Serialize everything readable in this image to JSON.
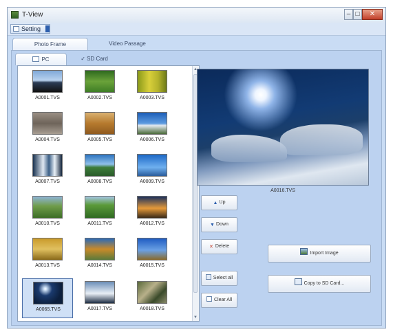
{
  "window": {
    "title": "T-View"
  },
  "menu": {
    "setting_label": "Setting"
  },
  "tabs_main": [
    {
      "label": "Photo Frame"
    },
    {
      "label": "Video Passage"
    }
  ],
  "tabs_source": [
    {
      "label": "PC"
    },
    {
      "label": "SD Card"
    }
  ],
  "thumbnails": [
    {
      "name": "A0001.TVS",
      "icon": "mountain-silhouette-photo"
    },
    {
      "name": "A0002.TVS",
      "icon": "green-field-photo"
    },
    {
      "name": "A0003.TVS",
      "icon": "yellow-grass-photo"
    },
    {
      "name": "A0004.TVS",
      "icon": "rocky-beach-photo"
    },
    {
      "name": "A0005.TVS",
      "icon": "desert-dunes-photo"
    },
    {
      "name": "A0006.TVS",
      "icon": "blue-sky-tree-photo"
    },
    {
      "name": "A0007.TVS",
      "icon": "waterfall-photo"
    },
    {
      "name": "A0008.TVS",
      "icon": "lake-landscape-photo"
    },
    {
      "name": "A0009.TVS",
      "icon": "blue-horizon-photo"
    },
    {
      "name": "A0010.TVS",
      "icon": "green-coast-photo"
    },
    {
      "name": "A0011.TVS",
      "icon": "green-meadow-photo"
    },
    {
      "name": "A0012.TVS",
      "icon": "sunset-tree-photo"
    },
    {
      "name": "A0013.TVS",
      "icon": "golden-field-photo"
    },
    {
      "name": "A0014.TVS",
      "icon": "river-autumn-photo"
    },
    {
      "name": "A0015.TVS",
      "icon": "blue-sky-field-photo"
    },
    {
      "name": "A0065.TVS",
      "icon": "moonlit-snow-photo",
      "selected": true
    },
    {
      "name": "A0017.TVS",
      "icon": "snowy-mountains-photo"
    },
    {
      "name": "A0018.TVS",
      "icon": "village-aerial-photo"
    }
  ],
  "preview": {
    "filename": "A0016.TVS",
    "icon": "moonlit-snow-preview"
  },
  "buttons": {
    "up": "Up",
    "down": "Down",
    "delete": "Delete",
    "select_all": "Select all",
    "clear_all": "Clear All",
    "import": "Import Image",
    "copy": "Copy to SD Card..."
  },
  "colors": {
    "panel_bg": "#c9dcf4",
    "accent": "#2d5fae",
    "close": "#c2402b"
  }
}
